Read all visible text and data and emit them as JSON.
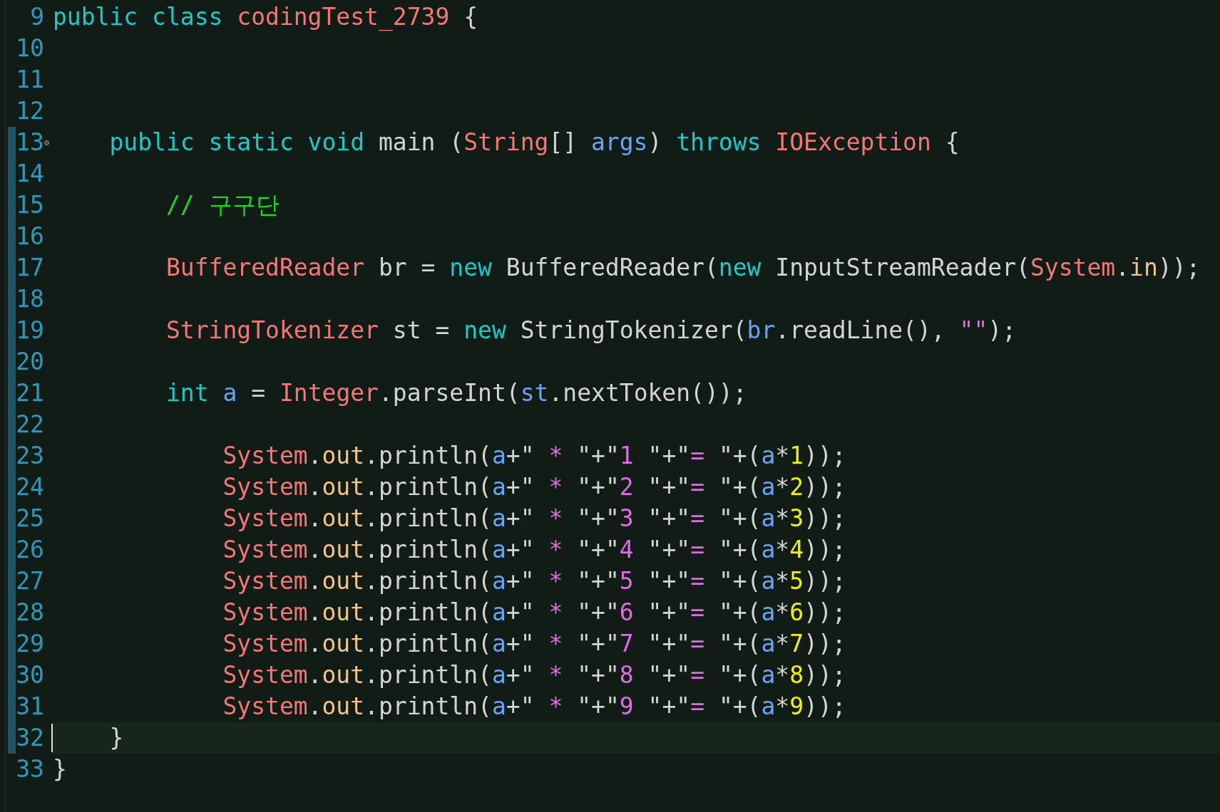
{
  "editor": {
    "lines": [
      {
        "number": "9",
        "changed": false,
        "foldable": false,
        "current": false,
        "tokens": [
          {
            "kind": "kw",
            "text": "public class "
          },
          {
            "kind": "type",
            "text": "codingTest_2739"
          },
          {
            "kind": "plain",
            "text": " {"
          }
        ]
      },
      {
        "number": "10",
        "changed": false,
        "foldable": false,
        "current": false
      },
      {
        "number": "11",
        "changed": false,
        "foldable": false,
        "current": false
      },
      {
        "number": "12",
        "changed": false,
        "foldable": false,
        "current": false
      },
      {
        "number": "13",
        "changed": true,
        "foldable": true,
        "current": false,
        "tokens": [
          {
            "kind": "kw",
            "text": "    public static void"
          },
          {
            "kind": "plain",
            "text": " main ("
          },
          {
            "kind": "type",
            "text": "String"
          },
          {
            "kind": "plain",
            "text": "[] "
          },
          {
            "kind": "var",
            "text": "args"
          },
          {
            "kind": "plain",
            "text": ") "
          },
          {
            "kind": "kw",
            "text": "throws "
          },
          {
            "kind": "type",
            "text": "IOException"
          },
          {
            "kind": "plain",
            "text": " {"
          }
        ]
      },
      {
        "number": "14",
        "changed": true,
        "foldable": false,
        "current": false
      },
      {
        "number": "15",
        "changed": true,
        "foldable": false,
        "current": false,
        "tokens": [
          {
            "kind": "comment",
            "text": "        // 구구단"
          }
        ]
      },
      {
        "number": "16",
        "changed": true,
        "foldable": false,
        "current": false
      },
      {
        "number": "17",
        "changed": true,
        "foldable": false,
        "current": false,
        "tokens": [
          {
            "kind": "type",
            "text": "        BufferedReader"
          },
          {
            "kind": "plain",
            "text": " br = "
          },
          {
            "kind": "kw",
            "text": "new"
          },
          {
            "kind": "plain",
            "text": " BufferedReader("
          },
          {
            "kind": "kw",
            "text": "new"
          },
          {
            "kind": "plain",
            "text": " InputStreamReader("
          },
          {
            "kind": "type",
            "text": "System"
          },
          {
            "kind": "plain",
            "text": "."
          },
          {
            "kind": "field",
            "text": "in"
          },
          {
            "kind": "plain",
            "text": "));"
          }
        ]
      },
      {
        "number": "18",
        "changed": true,
        "foldable": false,
        "current": false
      },
      {
        "number": "19",
        "changed": true,
        "foldable": false,
        "current": false,
        "tokens": [
          {
            "kind": "type",
            "text": "        StringTokenizer"
          },
          {
            "kind": "plain",
            "text": " st = "
          },
          {
            "kind": "kw",
            "text": "new"
          },
          {
            "kind": "plain",
            "text": " StringTokenizer("
          },
          {
            "kind": "var",
            "text": "br"
          },
          {
            "kind": "plain",
            "text": ".readLine(), "
          },
          {
            "kind": "str",
            "text": "\"\""
          },
          {
            "kind": "plain",
            "text": ");"
          }
        ]
      },
      {
        "number": "20",
        "changed": true,
        "foldable": false,
        "current": false
      },
      {
        "number": "21",
        "changed": true,
        "foldable": false,
        "current": false,
        "tokens": [
          {
            "kind": "kw",
            "text": "        int "
          },
          {
            "kind": "var",
            "text": "a"
          },
          {
            "kind": "plain",
            "text": " = "
          },
          {
            "kind": "type",
            "text": "Integer"
          },
          {
            "kind": "plain",
            "text": ".parseInt("
          },
          {
            "kind": "var",
            "text": "st"
          },
          {
            "kind": "plain",
            "text": ".nextToken());"
          }
        ]
      },
      {
        "number": "22",
        "changed": true,
        "foldable": false,
        "current": false
      },
      {
        "number": "23",
        "changed": true,
        "foldable": false,
        "current": false,
        "tokens": [
          {
            "kind": "type",
            "text": "            System"
          },
          {
            "kind": "plain",
            "text": "."
          },
          {
            "kind": "field",
            "text": "out"
          },
          {
            "kind": "plain",
            "text": ".println("
          },
          {
            "kind": "var",
            "text": "a"
          },
          {
            "kind": "plain",
            "text": "+\""
          },
          {
            "kind": "str",
            "text": " * "
          },
          {
            "kind": "plain",
            "text": "\"+\""
          },
          {
            "kind": "str",
            "text": "1 "
          },
          {
            "kind": "plain",
            "text": "\"+\""
          },
          {
            "kind": "str",
            "text": "= "
          },
          {
            "kind": "plain",
            "text": "\"+("
          },
          {
            "kind": "var",
            "text": "a"
          },
          {
            "kind": "plain",
            "text": "*"
          },
          {
            "kind": "num",
            "text": "1"
          },
          {
            "kind": "plain",
            "text": "));"
          }
        ]
      },
      {
        "number": "24",
        "changed": true,
        "foldable": false,
        "current": false,
        "tokens": [
          {
            "kind": "type",
            "text": "            System"
          },
          {
            "kind": "plain",
            "text": "."
          },
          {
            "kind": "field",
            "text": "out"
          },
          {
            "kind": "plain",
            "text": ".println("
          },
          {
            "kind": "var",
            "text": "a"
          },
          {
            "kind": "plain",
            "text": "+\""
          },
          {
            "kind": "str",
            "text": " * "
          },
          {
            "kind": "plain",
            "text": "\"+\""
          },
          {
            "kind": "str",
            "text": "2 "
          },
          {
            "kind": "plain",
            "text": "\"+\""
          },
          {
            "kind": "str",
            "text": "= "
          },
          {
            "kind": "plain",
            "text": "\"+("
          },
          {
            "kind": "var",
            "text": "a"
          },
          {
            "kind": "plain",
            "text": "*"
          },
          {
            "kind": "num",
            "text": "2"
          },
          {
            "kind": "plain",
            "text": "));"
          }
        ]
      },
      {
        "number": "25",
        "changed": true,
        "foldable": false,
        "current": false,
        "tokens": [
          {
            "kind": "type",
            "text": "            System"
          },
          {
            "kind": "plain",
            "text": "."
          },
          {
            "kind": "field",
            "text": "out"
          },
          {
            "kind": "plain",
            "text": ".println("
          },
          {
            "kind": "var",
            "text": "a"
          },
          {
            "kind": "plain",
            "text": "+\""
          },
          {
            "kind": "str",
            "text": " * "
          },
          {
            "kind": "plain",
            "text": "\"+\""
          },
          {
            "kind": "str",
            "text": "3 "
          },
          {
            "kind": "plain",
            "text": "\"+\""
          },
          {
            "kind": "str",
            "text": "= "
          },
          {
            "kind": "plain",
            "text": "\"+("
          },
          {
            "kind": "var",
            "text": "a"
          },
          {
            "kind": "plain",
            "text": "*"
          },
          {
            "kind": "num",
            "text": "3"
          },
          {
            "kind": "plain",
            "text": "));"
          }
        ]
      },
      {
        "number": "26",
        "changed": true,
        "foldable": false,
        "current": false,
        "tokens": [
          {
            "kind": "type",
            "text": "            System"
          },
          {
            "kind": "plain",
            "text": "."
          },
          {
            "kind": "field",
            "text": "out"
          },
          {
            "kind": "plain",
            "text": ".println("
          },
          {
            "kind": "var",
            "text": "a"
          },
          {
            "kind": "plain",
            "text": "+\""
          },
          {
            "kind": "str",
            "text": " * "
          },
          {
            "kind": "plain",
            "text": "\"+\""
          },
          {
            "kind": "str",
            "text": "4 "
          },
          {
            "kind": "plain",
            "text": "\"+\""
          },
          {
            "kind": "str",
            "text": "= "
          },
          {
            "kind": "plain",
            "text": "\"+("
          },
          {
            "kind": "var",
            "text": "a"
          },
          {
            "kind": "plain",
            "text": "*"
          },
          {
            "kind": "num",
            "text": "4"
          },
          {
            "kind": "plain",
            "text": "));"
          }
        ]
      },
      {
        "number": "27",
        "changed": true,
        "foldable": false,
        "current": false,
        "tokens": [
          {
            "kind": "type",
            "text": "            System"
          },
          {
            "kind": "plain",
            "text": "."
          },
          {
            "kind": "field",
            "text": "out"
          },
          {
            "kind": "plain",
            "text": ".println("
          },
          {
            "kind": "var",
            "text": "a"
          },
          {
            "kind": "plain",
            "text": "+\""
          },
          {
            "kind": "str",
            "text": " * "
          },
          {
            "kind": "plain",
            "text": "\"+\""
          },
          {
            "kind": "str",
            "text": "5 "
          },
          {
            "kind": "plain",
            "text": "\"+\""
          },
          {
            "kind": "str",
            "text": "= "
          },
          {
            "kind": "plain",
            "text": "\"+("
          },
          {
            "kind": "var",
            "text": "a"
          },
          {
            "kind": "plain",
            "text": "*"
          },
          {
            "kind": "num",
            "text": "5"
          },
          {
            "kind": "plain",
            "text": "));"
          }
        ]
      },
      {
        "number": "28",
        "changed": true,
        "foldable": false,
        "current": false,
        "tokens": [
          {
            "kind": "type",
            "text": "            System"
          },
          {
            "kind": "plain",
            "text": "."
          },
          {
            "kind": "field",
            "text": "out"
          },
          {
            "kind": "plain",
            "text": ".println("
          },
          {
            "kind": "var",
            "text": "a"
          },
          {
            "kind": "plain",
            "text": "+\""
          },
          {
            "kind": "str",
            "text": " * "
          },
          {
            "kind": "plain",
            "text": "\"+\""
          },
          {
            "kind": "str",
            "text": "6 "
          },
          {
            "kind": "plain",
            "text": "\"+\""
          },
          {
            "kind": "str",
            "text": "= "
          },
          {
            "kind": "plain",
            "text": "\"+("
          },
          {
            "kind": "var",
            "text": "a"
          },
          {
            "kind": "plain",
            "text": "*"
          },
          {
            "kind": "num",
            "text": "6"
          },
          {
            "kind": "plain",
            "text": "));"
          }
        ]
      },
      {
        "number": "29",
        "changed": true,
        "foldable": false,
        "current": false,
        "tokens": [
          {
            "kind": "type",
            "text": "            System"
          },
          {
            "kind": "plain",
            "text": "."
          },
          {
            "kind": "field",
            "text": "out"
          },
          {
            "kind": "plain",
            "text": ".println("
          },
          {
            "kind": "var",
            "text": "a"
          },
          {
            "kind": "plain",
            "text": "+\""
          },
          {
            "kind": "str",
            "text": " * "
          },
          {
            "kind": "plain",
            "text": "\"+\""
          },
          {
            "kind": "str",
            "text": "7 "
          },
          {
            "kind": "plain",
            "text": "\"+\""
          },
          {
            "kind": "str",
            "text": "= "
          },
          {
            "kind": "plain",
            "text": "\"+("
          },
          {
            "kind": "var",
            "text": "a"
          },
          {
            "kind": "plain",
            "text": "*"
          },
          {
            "kind": "num",
            "text": "7"
          },
          {
            "kind": "plain",
            "text": "));"
          }
        ]
      },
      {
        "number": "30",
        "changed": true,
        "foldable": false,
        "current": false,
        "tokens": [
          {
            "kind": "type",
            "text": "            System"
          },
          {
            "kind": "plain",
            "text": "."
          },
          {
            "kind": "field",
            "text": "out"
          },
          {
            "kind": "plain",
            "text": ".println("
          },
          {
            "kind": "var",
            "text": "a"
          },
          {
            "kind": "plain",
            "text": "+\""
          },
          {
            "kind": "str",
            "text": " * "
          },
          {
            "kind": "plain",
            "text": "\"+\""
          },
          {
            "kind": "str",
            "text": "8 "
          },
          {
            "kind": "plain",
            "text": "\"+\""
          },
          {
            "kind": "str",
            "text": "= "
          },
          {
            "kind": "plain",
            "text": "\"+("
          },
          {
            "kind": "var",
            "text": "a"
          },
          {
            "kind": "plain",
            "text": "*"
          },
          {
            "kind": "num",
            "text": "8"
          },
          {
            "kind": "plain",
            "text": "));"
          }
        ]
      },
      {
        "number": "31",
        "changed": true,
        "foldable": false,
        "current": false,
        "tokens": [
          {
            "kind": "type",
            "text": "            System"
          },
          {
            "kind": "plain",
            "text": "."
          },
          {
            "kind": "field",
            "text": "out"
          },
          {
            "kind": "plain",
            "text": ".println("
          },
          {
            "kind": "var",
            "text": "a"
          },
          {
            "kind": "plain",
            "text": "+\""
          },
          {
            "kind": "str",
            "text": " * "
          },
          {
            "kind": "plain",
            "text": "\"+\""
          },
          {
            "kind": "str",
            "text": "9 "
          },
          {
            "kind": "plain",
            "text": "\"+\""
          },
          {
            "kind": "str",
            "text": "= "
          },
          {
            "kind": "plain",
            "text": "\"+("
          },
          {
            "kind": "var",
            "text": "a"
          },
          {
            "kind": "plain",
            "text": "*"
          },
          {
            "kind": "num",
            "text": "9"
          },
          {
            "kind": "plain",
            "text": "));"
          }
        ]
      },
      {
        "number": "32",
        "changed": true,
        "foldable": false,
        "current": true,
        "tokens": [
          {
            "kind": "plain",
            "text": "    }"
          }
        ]
      },
      {
        "number": "33",
        "changed": false,
        "foldable": false,
        "current": false,
        "tokens": [
          {
            "kind": "plain",
            "text": "}"
          }
        ]
      }
    ]
  }
}
